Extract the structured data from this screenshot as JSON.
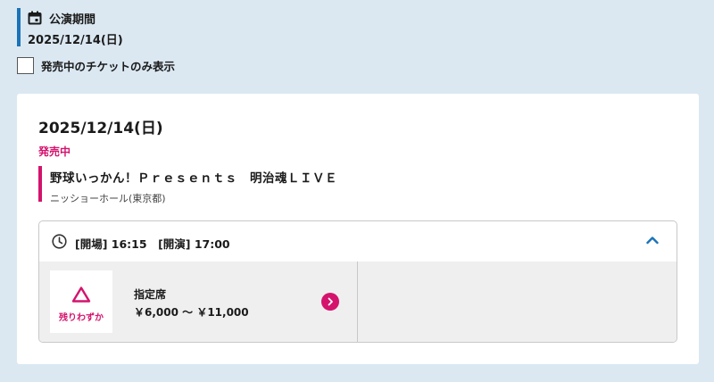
{
  "period": {
    "label": "公演期間",
    "date": "2025/12/14(日)",
    "icon": "calendar-icon"
  },
  "filter": {
    "label": "発売中のチケットのみ表示",
    "checked": false
  },
  "card": {
    "date": "2025/12/14(日)",
    "sale_status": "発売中",
    "title": "野球いっかん！Ｐｒｅｓｅｎｔｓ　明治魂ＬＩＶＥ",
    "venue": "ニッショーホール(東京都)",
    "performance": {
      "time": "[開場] 16:15　[開演] 17:00",
      "icon": "clock-icon",
      "tickets": [
        {
          "availability_icon": "triangle-icon",
          "availability_text": "残りわずか",
          "seat_type": "指定席",
          "price": "￥6,000 ～ ￥11,000"
        }
      ]
    }
  },
  "colors": {
    "accent_blue": "#1a73b8",
    "accent_pink": "#d4136d",
    "background": "#dbe8f2"
  }
}
